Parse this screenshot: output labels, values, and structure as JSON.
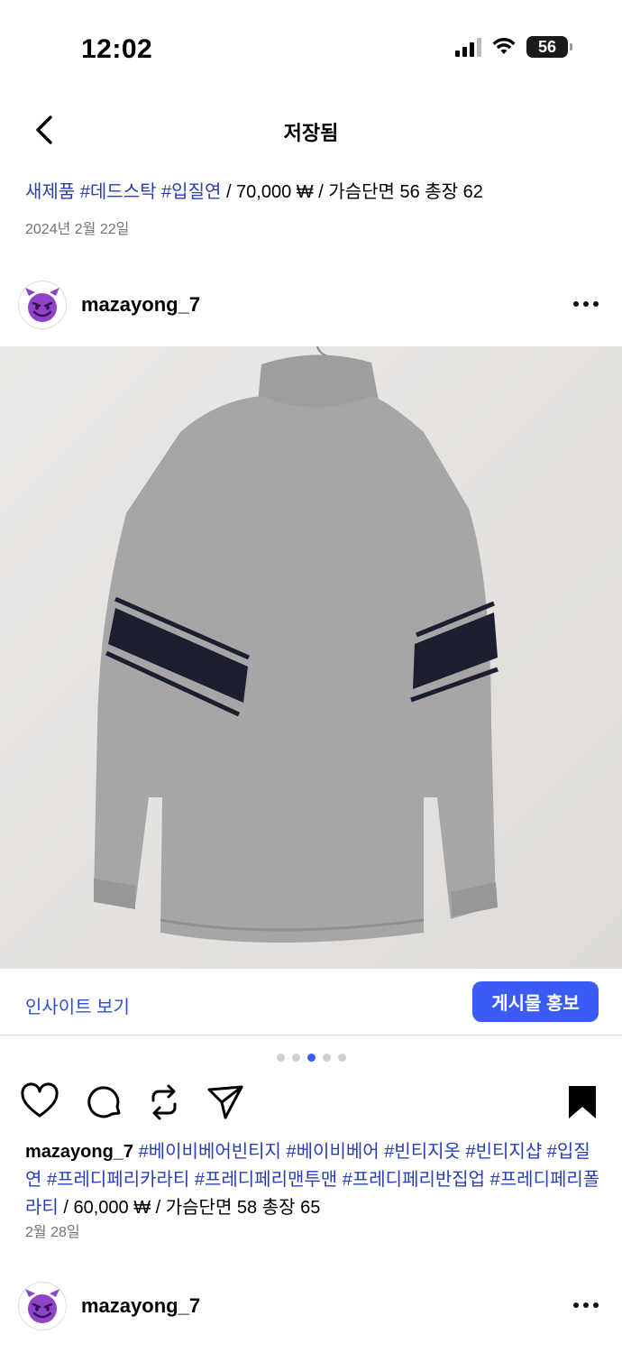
{
  "status_bar": {
    "time": "12:02",
    "battery": "56"
  },
  "nav": {
    "title": "저장됨"
  },
  "post1": {
    "caption_tags": [
      "새제품",
      "#데드스탁",
      "#입질연"
    ],
    "caption_text": " / 70,000 ₩ / 가슴단면 56 총장 62",
    "date": "2024년 2월 22일"
  },
  "post2": {
    "username": "mazayong_7",
    "insight_label": "인사이트 보기",
    "promote_label": "게시물 홍보",
    "carousel": {
      "count": 5,
      "active_index": 2
    },
    "caption_user": "mazayong_7",
    "caption_tags": [
      "#베이비베어빈티지",
      "#베이비베어",
      "#빈티지옷",
      "#빈티지샵",
      "#입질연",
      "#프레디페리카라티",
      "#프레디페리맨투맨",
      "#프레디페리반집업",
      "#프레디페리폴라티"
    ],
    "caption_text": " / 60,000 ₩ / 가슴단면 58 총장 65",
    "date": "2월 28일"
  },
  "post3": {
    "username": "mazayong_7"
  },
  "icons": {
    "back": "chevron-left-icon",
    "more": "more-horizontal-icon",
    "like": "heart-icon",
    "comment": "comment-icon",
    "repost": "repost-icon",
    "share": "send-icon",
    "save": "bookmark-icon"
  },
  "colors": {
    "accent": "#3b5bf5",
    "hashtag": "#2b3fb5",
    "avatar_purple": "#8e44c9"
  }
}
